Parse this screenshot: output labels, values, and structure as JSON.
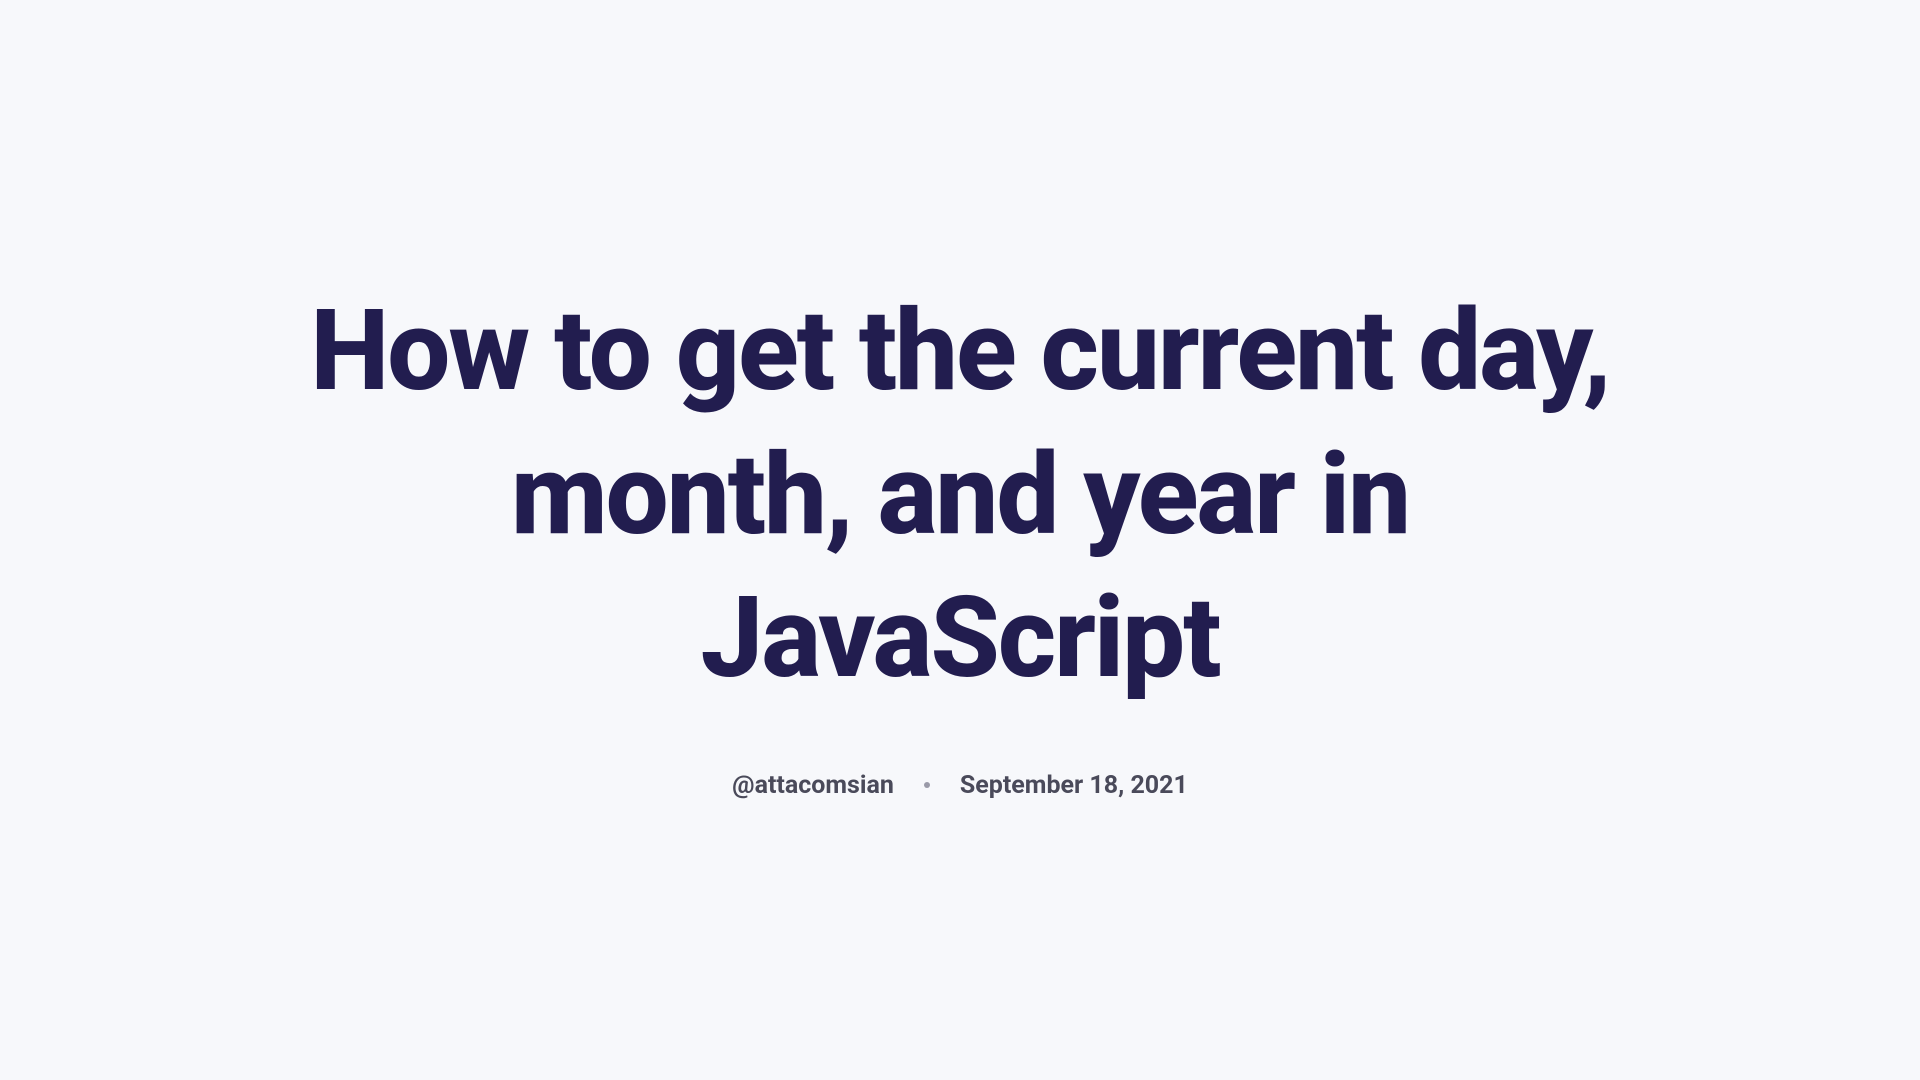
{
  "article": {
    "title": "How to get the current day, month, and year in JavaScript",
    "author": "@attacomsian",
    "date": "September 18, 2021"
  }
}
